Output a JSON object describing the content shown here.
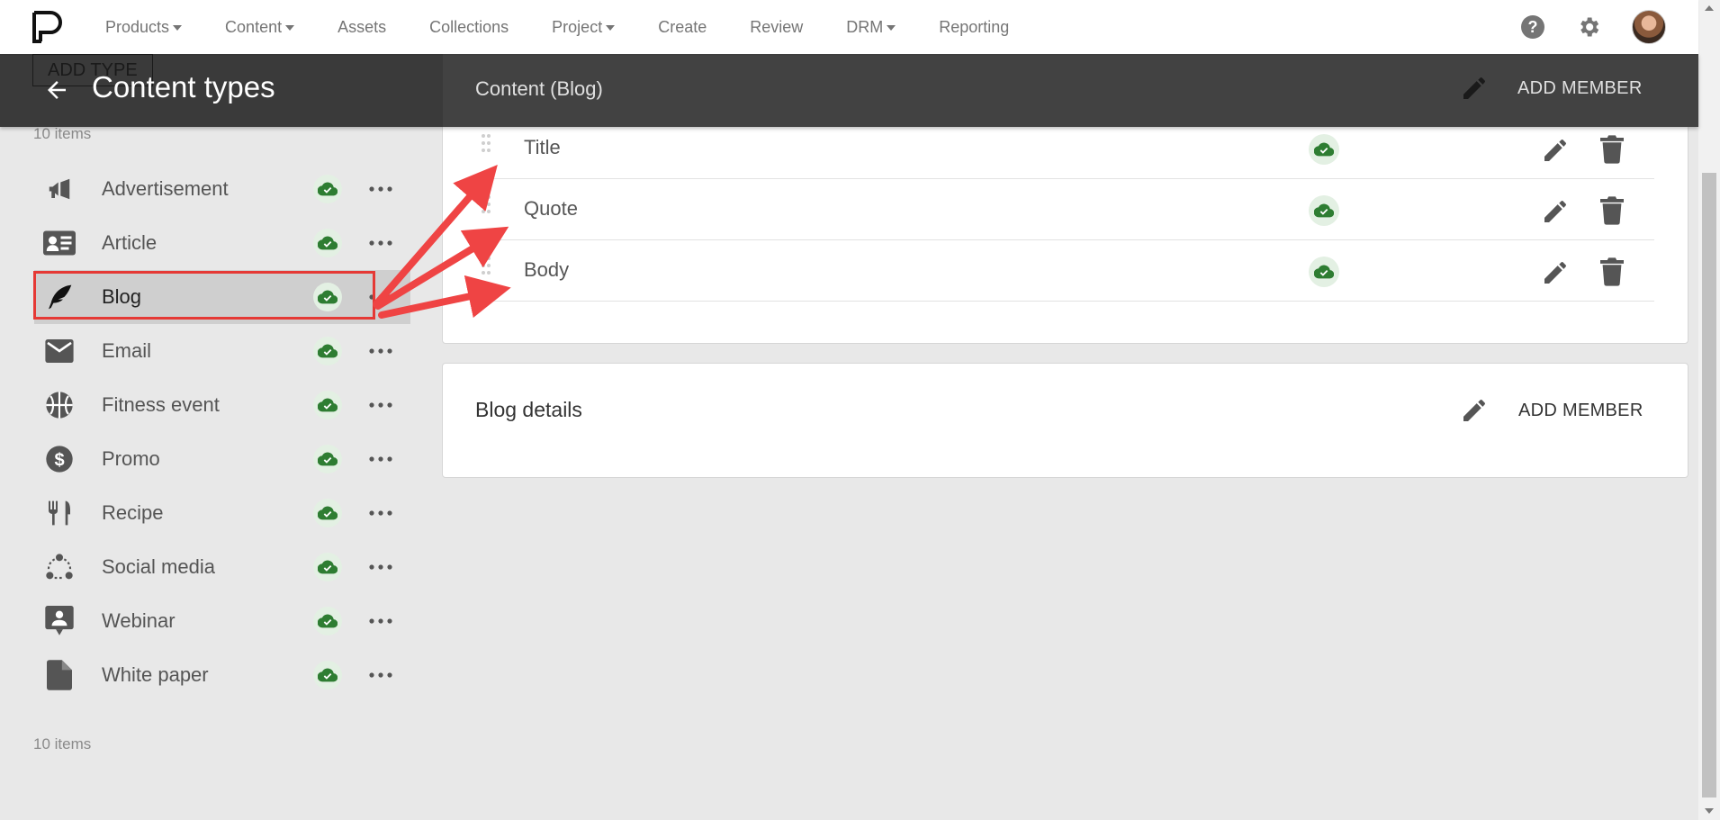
{
  "nav": {
    "logo": "pd-logo",
    "items": [
      {
        "label": "Products",
        "dropdown": true
      },
      {
        "label": "Content",
        "dropdown": true
      },
      {
        "label": "Assets",
        "dropdown": false
      },
      {
        "label": "Collections",
        "dropdown": false
      },
      {
        "label": "Project",
        "dropdown": true
      },
      {
        "label": "Create",
        "dropdown": false
      },
      {
        "label": "Review",
        "dropdown": false
      },
      {
        "label": "DRM",
        "dropdown": true
      },
      {
        "label": "Reporting",
        "dropdown": false
      }
    ],
    "right_icons": [
      "help-icon",
      "gear-icon",
      "avatar"
    ]
  },
  "header": {
    "title": "Content types",
    "add_type_label": "ADD TYPE",
    "panel_title": "Content (Blog)",
    "panel_add_member": "ADD MEMBER"
  },
  "types": {
    "count_top": "10 items",
    "count_bottom": "10 items",
    "items": [
      {
        "label": "Advertisement",
        "icon": "megaphone-icon",
        "selected": false
      },
      {
        "label": "Article",
        "icon": "id-card-icon",
        "selected": false
      },
      {
        "label": "Blog",
        "icon": "feather-icon",
        "selected": true
      },
      {
        "label": "Email",
        "icon": "envelope-icon",
        "selected": false
      },
      {
        "label": "Fitness event",
        "icon": "basketball-icon",
        "selected": false
      },
      {
        "label": "Promo",
        "icon": "dollar-icon",
        "selected": false
      },
      {
        "label": "Recipe",
        "icon": "utensils-icon",
        "selected": false
      },
      {
        "label": "Social media",
        "icon": "share-network-icon",
        "selected": false
      },
      {
        "label": "Webinar",
        "icon": "presenter-icon",
        "selected": false
      },
      {
        "label": "White paper",
        "icon": "document-icon",
        "selected": false
      }
    ]
  },
  "content_members": [
    {
      "label": "Title"
    },
    {
      "label": "Quote"
    },
    {
      "label": "Body"
    }
  ],
  "details": {
    "title": "Blog details",
    "add_member": "ADD MEMBER"
  },
  "colors": {
    "accent_green": "#2e7d32",
    "annotation_red": "#e53935",
    "dark_bar": "#424242"
  }
}
